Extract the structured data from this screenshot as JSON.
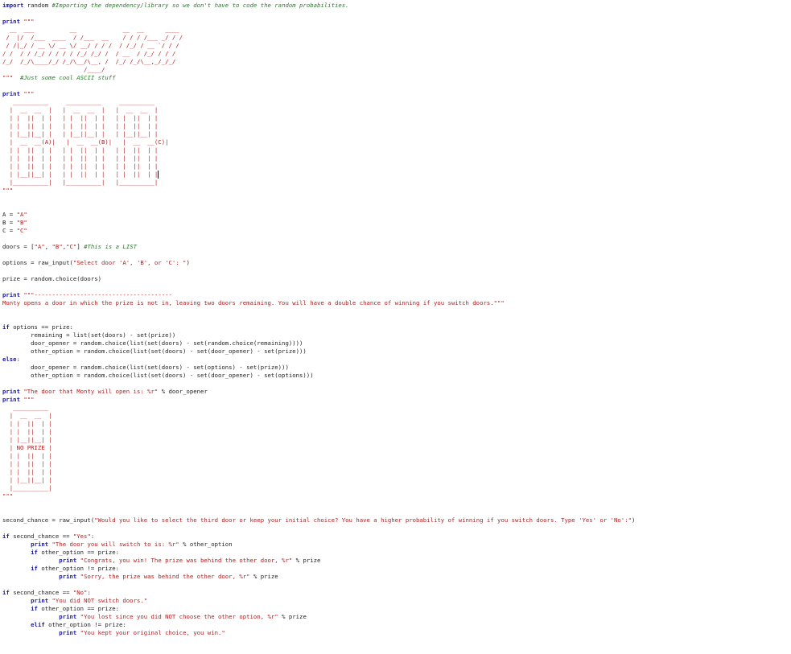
{
  "editor": {
    "lines": [
      [
        {
          "t": "import",
          "c": "kw"
        },
        {
          "t": " random ",
          "c": ""
        },
        {
          "t": "#Importing the dependency/library so we don't have to code the random probabilities.",
          "c": "cm"
        }
      ],
      [],
      [
        {
          "t": "print",
          "c": "kw"
        },
        {
          "t": " ",
          "c": ""
        },
        {
          "t": "\"\"\"",
          "c": "st"
        }
      ],
      [
        {
          "t": "  __  ___          __             __  __      ____",
          "c": "art"
        }
      ],
      [
        {
          "t": " /  |/  /___  ____  / /___  __    / / / /___ _/ / /",
          "c": "art"
        }
      ],
      [
        {
          "t": " / /|_/ / __ \\/ __ \\/ __/ / / /  / /_/ / __ `/ / / ",
          "c": "art"
        }
      ],
      [
        {
          "t": "/ /  / / /_/ / / / / /_/ /_/ /  / __  / /_/ / / /  ",
          "c": "art"
        }
      ],
      [
        {
          "t": "/_/  /_/\\____/_/ /_/\\__/\\__, /  /_/ /_/\\__,_/_/_/   ",
          "c": "art"
        }
      ],
      [
        {
          "t": "                       /____/                       ",
          "c": "art"
        }
      ],
      [
        {
          "t": "\"\"\"",
          "c": "st"
        },
        {
          "t": "  ",
          "c": ""
        },
        {
          "t": "#Just some cool ASCII stuff",
          "c": "cm"
        }
      ],
      [],
      [
        {
          "t": "print",
          "c": "kw"
        },
        {
          "t": " ",
          "c": ""
        },
        {
          "t": "\"\"\"",
          "c": "st"
        }
      ],
      [
        {
          "t": "   __________     __________     __________",
          "c": "art"
        }
      ],
      [
        {
          "t": "  |  __  __  |   |  __  __  |   |  __  __  |",
          "c": "art"
        }
      ],
      [
        {
          "t": "  | |  ||  | |   | |  ||  | |   | |  ||  | |",
          "c": "art"
        }
      ],
      [
        {
          "t": "  | |  ||  | |   | |  ||  | |   | |  ||  | |",
          "c": "art"
        }
      ],
      [
        {
          "t": "  | |__||__| |   | |__||__| |   | |__||__| |",
          "c": "art"
        }
      ],
      [
        {
          "t": "  |  __  __(A)|   |  __  __(B)|   |  __  __(C)|",
          "c": "art"
        }
      ],
      [
        {
          "t": "  | |  ||  | |   | |  ||  | |   | |  ||  | |",
          "c": "art"
        }
      ],
      [
        {
          "t": "  | |  ||  | |   | |  ||  | |   | |  ||  | |",
          "c": "art"
        }
      ],
      [
        {
          "t": "  | |  ||  | |   | |  ||  | |   | |  ||  | |",
          "c": "art"
        }
      ],
      [
        {
          "t": "  | |__||__| |   | |  ||  | |   | |  ||  | |",
          "c": "art"
        }
      ],
      [
        {
          "t": "  |__________|   |__________|   |__________|",
          "c": "art"
        }
      ],
      [
        {
          "t": "\"\"\"",
          "c": "st"
        }
      ],
      [],
      [],
      [
        {
          "t": "A = ",
          "c": ""
        },
        {
          "t": "\"A\"",
          "c": "st"
        }
      ],
      [
        {
          "t": "B = ",
          "c": ""
        },
        {
          "t": "\"B\"",
          "c": "st"
        }
      ],
      [
        {
          "t": "C = ",
          "c": ""
        },
        {
          "t": "\"C\"",
          "c": "st"
        }
      ],
      [],
      [
        {
          "t": "doors = [",
          "c": ""
        },
        {
          "t": "\"A\"",
          "c": "st"
        },
        {
          "t": ", ",
          "c": ""
        },
        {
          "t": "\"B\"",
          "c": "st"
        },
        {
          "t": ",",
          "c": ""
        },
        {
          "t": "\"C\"",
          "c": "st"
        },
        {
          "t": "] ",
          "c": ""
        },
        {
          "t": "#This is a LIST",
          "c": "cm"
        }
      ],
      [],
      [
        {
          "t": "options = raw_input(",
          "c": ""
        },
        {
          "t": "\"Select door 'A', 'B', or 'C': \"",
          "c": "st"
        },
        {
          "t": ")",
          "c": ""
        }
      ],
      [],
      [
        {
          "t": "prize = random.choice(doors)",
          "c": ""
        }
      ],
      [],
      [
        {
          "t": "print",
          "c": "kw"
        },
        {
          "t": " ",
          "c": ""
        },
        {
          "t": "\"\"\"---------------------------------------",
          "c": "st"
        }
      ],
      [
        {
          "t": "Monty opens a door in which the prize is not in, leaving two doors remaining. You will have a double chance of winning if you switch doors.\"\"\"",
          "c": "st"
        }
      ],
      [],
      [],
      [
        {
          "t": "if",
          "c": "kw"
        },
        {
          "t": " options == prize:",
          "c": ""
        }
      ],
      [
        {
          "t": "        remaining = list(set(doors) - set(prize))",
          "c": ""
        }
      ],
      [
        {
          "t": "        door_opener = random.choice(list(set(doors) - set(random.choice(remaining))))",
          "c": ""
        }
      ],
      [
        {
          "t": "        other_option = random.choice(list(set(doors) - set(door_opener) - set(prize)))",
          "c": ""
        }
      ],
      [
        {
          "t": "else",
          "c": "kw"
        },
        {
          "t": ":",
          "c": ""
        }
      ],
      [
        {
          "t": "        door_opener = random.choice(list(set(doors) - set(options) - set(prize)))",
          "c": ""
        }
      ],
      [
        {
          "t": "        other_option = random.choice(list(set(doors) - set(door_opener) - set(options)))",
          "c": ""
        }
      ],
      [],
      [
        {
          "t": "print",
          "c": "kw"
        },
        {
          "t": " ",
          "c": ""
        },
        {
          "t": "\"The door that Monty will open is: %r\"",
          "c": "st"
        },
        {
          "t": " % door_opener",
          "c": ""
        }
      ],
      [
        {
          "t": "print",
          "c": "kw"
        },
        {
          "t": " ",
          "c": ""
        },
        {
          "t": "\"\"\"",
          "c": "st"
        }
      ],
      [
        {
          "t": "   __________",
          "c": "art"
        }
      ],
      [
        {
          "t": "  |  __  __  |",
          "c": "art"
        }
      ],
      [
        {
          "t": "  | |  ||  | |",
          "c": "art"
        }
      ],
      [
        {
          "t": "  | |  ||  | |",
          "c": "art"
        }
      ],
      [
        {
          "t": "  | |__||__| |",
          "c": "art"
        }
      ],
      [
        {
          "t": "  | NO PRIZE |",
          "c": "art"
        }
      ],
      [
        {
          "t": "  | |  ||  | |",
          "c": "art"
        }
      ],
      [
        {
          "t": "  | |  ||  | |",
          "c": "art"
        }
      ],
      [
        {
          "t": "  | |  ||  | |",
          "c": "art"
        }
      ],
      [
        {
          "t": "  | |__||__| |",
          "c": "art"
        }
      ],
      [
        {
          "t": "  |__________|",
          "c": "art"
        }
      ],
      [
        {
          "t": "\"\"\"",
          "c": "st"
        }
      ],
      [],
      [],
      [
        {
          "t": "second_chance = raw_input(",
          "c": ""
        },
        {
          "t": "\"Would you like to select the third door or keep your initial choice? You have a higher probability of winning if you switch doors. Type 'Yes' or 'No':\"",
          "c": "st"
        },
        {
          "t": ")",
          "c": ""
        }
      ],
      [],
      [
        {
          "t": "if",
          "c": "kw"
        },
        {
          "t": " second_chance == ",
          "c": ""
        },
        {
          "t": "\"Yes\"",
          "c": "st"
        },
        {
          "t": ":",
          "c": ""
        }
      ],
      [
        {
          "t": "        ",
          "c": ""
        },
        {
          "t": "print",
          "c": "kw"
        },
        {
          "t": " ",
          "c": ""
        },
        {
          "t": "\"The door you will switch to is: %r\"",
          "c": "st"
        },
        {
          "t": " % other_option",
          "c": ""
        }
      ],
      [
        {
          "t": "        ",
          "c": ""
        },
        {
          "t": "if",
          "c": "kw"
        },
        {
          "t": " other_option == prize:",
          "c": ""
        }
      ],
      [
        {
          "t": "                ",
          "c": ""
        },
        {
          "t": "print",
          "c": "kw"
        },
        {
          "t": " ",
          "c": ""
        },
        {
          "t": "\"Congrats, you win! The prize was behind the other door, %r\"",
          "c": "st"
        },
        {
          "t": " % prize",
          "c": ""
        }
      ],
      [
        {
          "t": "        ",
          "c": ""
        },
        {
          "t": "if",
          "c": "kw"
        },
        {
          "t": " other_option != prize:",
          "c": ""
        }
      ],
      [
        {
          "t": "                ",
          "c": ""
        },
        {
          "t": "print",
          "c": "kw"
        },
        {
          "t": " ",
          "c": ""
        },
        {
          "t": "\"Sorry, the prize was behind the other door, %r\"",
          "c": "st"
        },
        {
          "t": " % prize",
          "c": ""
        }
      ],
      [],
      [
        {
          "t": "if",
          "c": "kw"
        },
        {
          "t": " second_chance == ",
          "c": ""
        },
        {
          "t": "\"No\"",
          "c": "st"
        },
        {
          "t": ":",
          "c": ""
        }
      ],
      [
        {
          "t": "        ",
          "c": ""
        },
        {
          "t": "print",
          "c": "kw"
        },
        {
          "t": " ",
          "c": ""
        },
        {
          "t": "\"You did NOT switch doors.\"",
          "c": "st"
        }
      ],
      [
        {
          "t": "        ",
          "c": ""
        },
        {
          "t": "if",
          "c": "kw"
        },
        {
          "t": " other_option == prize:",
          "c": ""
        }
      ],
      [
        {
          "t": "                ",
          "c": ""
        },
        {
          "t": "print",
          "c": "kw"
        },
        {
          "t": " ",
          "c": ""
        },
        {
          "t": "\"You lost since you did NOT choose the other option, %r\"",
          "c": "st"
        },
        {
          "t": " % prize",
          "c": ""
        }
      ],
      [
        {
          "t": "        ",
          "c": ""
        },
        {
          "t": "elif",
          "c": "kw"
        },
        {
          "t": " other_option != prize:",
          "c": ""
        }
      ],
      [
        {
          "t": "                ",
          "c": ""
        },
        {
          "t": "print",
          "c": "kw"
        },
        {
          "t": " ",
          "c": ""
        },
        {
          "t": "\"You kept your original choice, you win.\"",
          "c": "st"
        }
      ]
    ]
  }
}
